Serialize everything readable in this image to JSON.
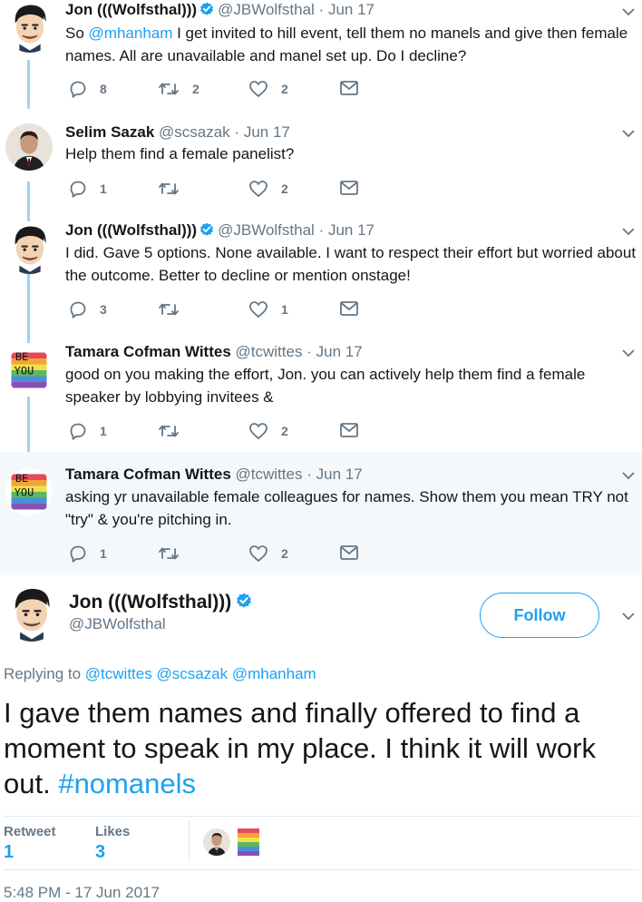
{
  "tweets": [
    {
      "name": "Jon (((Wolfsthal)))",
      "verified": true,
      "handle": "@JBWolfsthal",
      "sep": "·",
      "date": "Jun 17",
      "text_parts": [
        "So ",
        "@mhanham",
        " I get invited to hill event, tell them no manels and give then female names. All are unavailable and manel set up. Do I decline?"
      ],
      "replies": "8",
      "retweets": "2",
      "likes": "2"
    },
    {
      "name": "Selim Sazak",
      "verified": false,
      "handle": "@scsazak",
      "sep": "·",
      "date": "Jun 17",
      "text": "Help them find a female panelist?",
      "replies": "1",
      "retweets": "",
      "likes": "2"
    },
    {
      "name": "Jon (((Wolfsthal)))",
      "verified": true,
      "handle": "@JBWolfsthal",
      "sep": "·",
      "date": "Jun 17",
      "text": "I did. Gave 5 options. None available. I want to respect their effort but worried about the outcome. Better to decline or mention onstage!",
      "replies": "3",
      "retweets": "",
      "likes": "1"
    },
    {
      "name": "Tamara Cofman Wittes",
      "verified": false,
      "handle": "@tcwittes",
      "sep": "·",
      "date": "Jun 17",
      "text": "good on you making the effort, Jon. you can actively help them find a female speaker by lobbying invitees &",
      "replies": "1",
      "retweets": "",
      "likes": "2"
    },
    {
      "name": "Tamara Cofman Wittes",
      "verified": false,
      "handle": "@tcwittes",
      "sep": "·",
      "date": "Jun 17",
      "text": "asking yr unavailable female colleagues for names. Show them you mean TRY not \"try\" & you're pitching in.",
      "replies": "1",
      "retweets": "",
      "likes": "2"
    }
  ],
  "main": {
    "name": "Jon (((Wolfsthal)))",
    "handle": "@JBWolfsthal",
    "follow_label": "Follow",
    "replying_prefix": "Replying to ",
    "replying_to": "@tcwittes @scsazak @mhanham",
    "text": "I gave them names and finally offered to find a moment to speak in my place. I think it will work out. ",
    "hashtag": "#nomanels",
    "retweets_label": "Retweet",
    "retweets_value": "1",
    "likes_label": "Likes",
    "likes_value": "3",
    "timestamp": "5:48 PM - 17 Jun 2017"
  },
  "avatars": {
    "be_you_text": [
      "BE",
      "YOU"
    ]
  },
  "colors": {
    "accent": "#1da1f2",
    "muted": "#657786",
    "thread_line": "#9fd2f6",
    "highlight_bg": "#f5f8fa"
  }
}
